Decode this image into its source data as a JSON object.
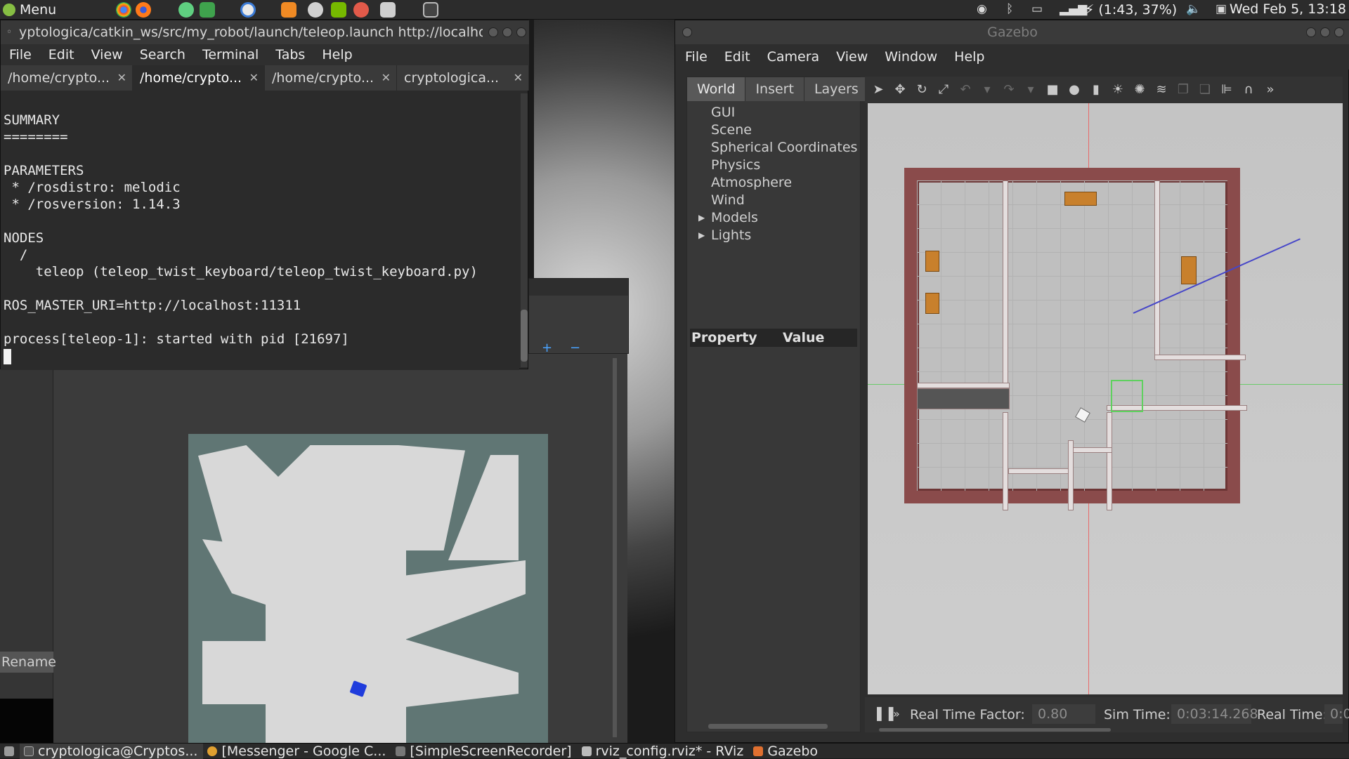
{
  "top_panel": {
    "menu_label": "Menu",
    "tray": {
      "battery": "(1:43, 37%)",
      "clock": "Wed Feb  5, 13:18"
    },
    "launchers": [
      "chrome-icon",
      "firefox-icon",
      "chat-icon",
      "spreadsheet-icon",
      "skype-icon",
      "sublime-icon",
      "vlc-icon",
      "nvidia-icon",
      "paint-icon",
      "text-editor-icon",
      "terminal-icon"
    ]
  },
  "terminal": {
    "title": "yptologica/catkin_ws/src/my_robot/launch/teleop.launch http://localho",
    "menu": [
      "File",
      "Edit",
      "View",
      "Search",
      "Terminal",
      "Tabs",
      "Help"
    ],
    "tabs": [
      "/home/crypto...",
      "/home/crypto...",
      "/home/crypto...",
      "cryptologica..."
    ],
    "active_tab": 1,
    "lines": [
      "",
      "SUMMARY",
      "========",
      "",
      "PARAMETERS",
      " * /rosdistro: melodic",
      " * /rosversion: 1.14.3",
      "",
      "NODES",
      "  /",
      "    teleop (teleop_twist_keyboard/teleop_twist_keyboard.py)",
      "",
      "ROS_MASTER_URI=http://localhost:11311",
      "",
      "process[teleop-1]: started with pid [21697]"
    ]
  },
  "rviz": {
    "rename_label": "Rename",
    "zoom_in": "+",
    "zoom_out": "−"
  },
  "gazebo": {
    "title": "Gazebo",
    "menu": [
      "File",
      "Edit",
      "Camera",
      "View",
      "Window",
      "Help"
    ],
    "tabs": [
      "World",
      "Insert",
      "Layers"
    ],
    "tree": [
      {
        "label": "GUI",
        "expandable": false
      },
      {
        "label": "Scene",
        "expandable": false
      },
      {
        "label": "Spherical Coordinates",
        "expandable": false
      },
      {
        "label": "Physics",
        "expandable": false
      },
      {
        "label": "Atmosphere",
        "expandable": false
      },
      {
        "label": "Wind",
        "expandable": false
      },
      {
        "label": "Models",
        "expandable": true
      },
      {
        "label": "Lights",
        "expandable": true
      }
    ],
    "property_header": "Property",
    "value_header": "Value",
    "status": {
      "rtf_label": "Real Time Factor:",
      "rtf_value": "0.80",
      "sim_time_label": "Sim Time:",
      "sim_time_value": "0:03:14.268",
      "real_time_label": "Real Time:",
      "real_time_value": "0:0"
    }
  },
  "taskbar": {
    "items": [
      {
        "label": "cryptologica@Cryptos...",
        "icon": "terminal-icon"
      },
      {
        "label": "[Messenger - Google C...",
        "icon": "chrome-icon"
      },
      {
        "label": "[SimpleScreenRecorder]",
        "icon": "recorder-icon"
      },
      {
        "label": "rviz_config.rviz* - RViz",
        "icon": "rviz-icon"
      },
      {
        "label": "Gazebo",
        "icon": "gazebo-icon"
      }
    ]
  },
  "colors": {
    "house_wall": "#8a4b4b",
    "map_background": "#607674",
    "robot": "#1f3cdc"
  }
}
